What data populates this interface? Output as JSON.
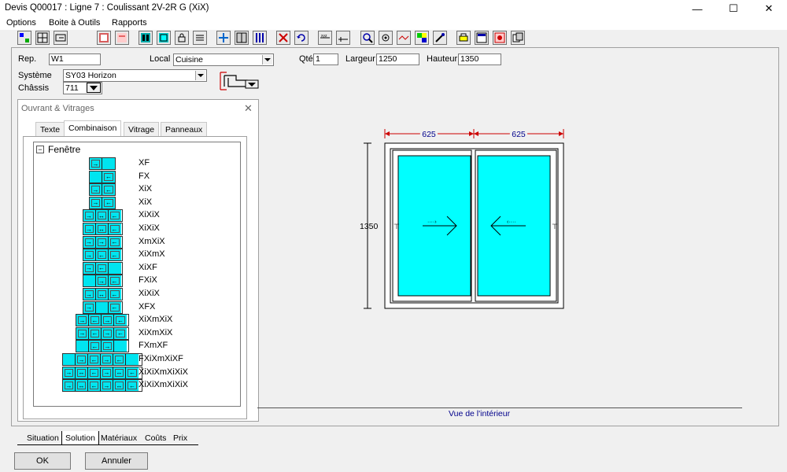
{
  "window": {
    "title": "Devis Q00017   : Ligne  7 : Coulissant 2V-2R G (XiX)",
    "minimize": "—",
    "maximize": "☐",
    "close": "✕"
  },
  "menu": [
    "Options",
    "Boite à Outils",
    "Rapports"
  ],
  "form": {
    "rep_label": "Rep.",
    "rep_value": "W1",
    "local_label": "Local",
    "local_value": "Cuisine",
    "qte_label": "Qté",
    "qte_value": "1",
    "largeur_label": "Largeur",
    "largeur_value": "1250",
    "hauteur_label": "Hauteur",
    "hauteur_value": "1350",
    "systeme_label": "Système",
    "systeme_value": "SY03  Horizon",
    "chassis_label": "Châssis",
    "chassis_value": "711"
  },
  "panel": {
    "title": "Ouvrant & Vitrages",
    "tabs": [
      "Texte",
      "Combinaison",
      "Vitrage",
      "Panneaux"
    ],
    "active_tab": "Combinaison",
    "tree_root": "Fenêtre",
    "tree_expander": "−",
    "combinations": [
      {
        "name": "XF",
        "panes": [
          "→",
          ""
        ]
      },
      {
        "name": "FX",
        "panes": [
          "",
          "←"
        ]
      },
      {
        "name": "XiX",
        "panes": [
          "→",
          "←"
        ]
      },
      {
        "name": "XiX",
        "panes": [
          "→",
          "←"
        ]
      },
      {
        "name": "XiXiX",
        "panes": [
          "→",
          "↔",
          "←"
        ]
      },
      {
        "name": "XiXiX",
        "panes": [
          "→",
          "↔",
          "←"
        ]
      },
      {
        "name": "XmXiX",
        "panes": [
          "→",
          "→",
          "←"
        ]
      },
      {
        "name": "XiXmX",
        "panes": [
          "→",
          "←",
          "←"
        ]
      },
      {
        "name": "XiXF",
        "panes": [
          "→",
          "←",
          ""
        ]
      },
      {
        "name": "FXiX",
        "panes": [
          "",
          "→",
          "←"
        ]
      },
      {
        "name": "XiXiX",
        "panes": [
          "→",
          "↔",
          "←"
        ]
      },
      {
        "name": "XFX",
        "panes": [
          "→",
          "",
          "←"
        ]
      },
      {
        "name": "XiXmXiX",
        "panes": [
          "→",
          "←",
          "→",
          "←"
        ]
      },
      {
        "name": "XiXmXiX",
        "panes": [
          "→",
          "←",
          "→",
          "←"
        ]
      },
      {
        "name": "FXmXF",
        "panes": [
          "",
          "←",
          "→",
          ""
        ]
      },
      {
        "name": "FXiXmXiXF",
        "panes": [
          "",
          "→",
          "←",
          "→",
          "←",
          ""
        ]
      },
      {
        "name": "XiXiXmXiXiX",
        "panes": [
          "→",
          "↔",
          "←",
          "→",
          "↔",
          "←"
        ]
      },
      {
        "name": "XiXiXmXiXiX",
        "panes": [
          "→",
          "↔",
          "←",
          "→",
          "↔",
          "←"
        ]
      }
    ]
  },
  "drawing": {
    "dim_left": "625",
    "dim_right": "625",
    "dim_height": "1350",
    "view_label": "Vue de l'intérieur",
    "glass_color": "#00ffff"
  },
  "bottom_tabs": [
    "Situation",
    "Solution",
    "Matériaux",
    "Coûts",
    "Prix"
  ],
  "active_bottom_tab": "Solution",
  "buttons": {
    "ok": "OK",
    "cancel": "Annuler"
  },
  "toolbar_icons": [
    "tree-icon",
    "grid-icon",
    "panel-icon",
    "export-icon",
    "report-icon",
    "pane-icon",
    "glass-icon",
    "lock-icon",
    "list-icon",
    "cross-icon",
    "split-icon",
    "bars-icon",
    "delete-icon",
    "undo-icon",
    "dimension-icon",
    "measure-icon",
    "zoom-icon",
    "hardware-icon",
    "profile-icon",
    "color-icon",
    "wrench-icon",
    "print-icon",
    "window-icon",
    "image-icon",
    "copy-icon"
  ]
}
